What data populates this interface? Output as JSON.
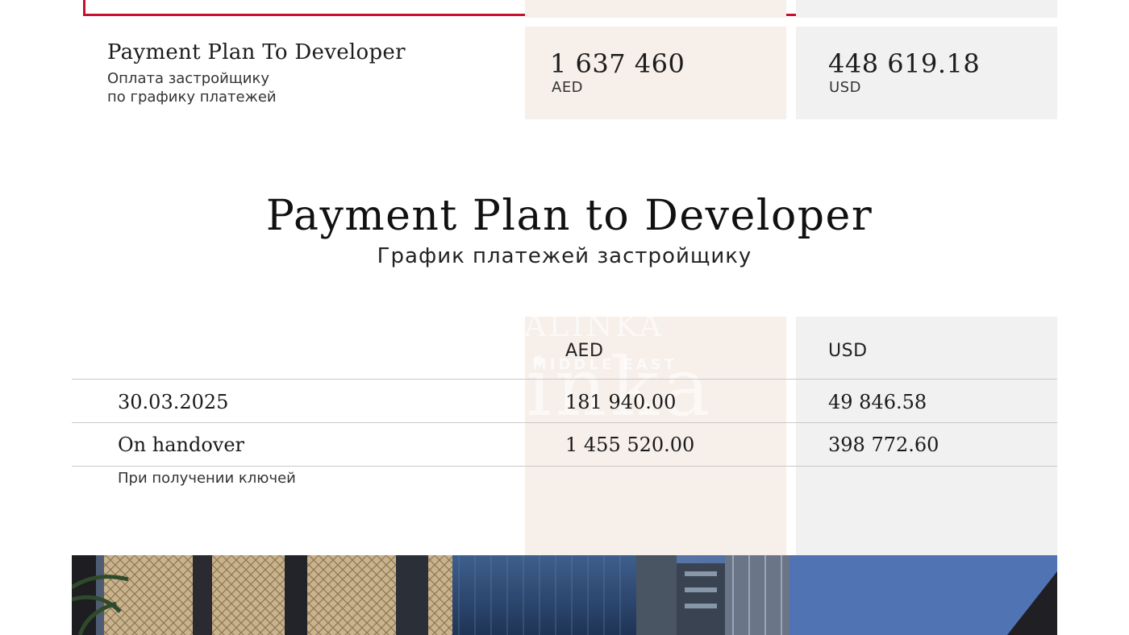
{
  "summary": {
    "label": "Payment Plan To Developer",
    "sublabel_line1": "Оплата застройщику",
    "sublabel_line2": "по графику платежей",
    "aed_amount": "1 637 460",
    "aed_currency": "AED",
    "usd_amount": "448 619.18",
    "usd_currency": "USD"
  },
  "section": {
    "title": "Payment Plan to Developer",
    "subtitle": "График платежей застройщику"
  },
  "table": {
    "columns": [
      "AED",
      "USD"
    ],
    "rows": [
      {
        "label": "30.03.2025",
        "aed": "181 940.00",
        "usd": "49 846.58"
      },
      {
        "label": "On handover",
        "aed": "1 455 520.00",
        "usd": "398 772.60",
        "note": "При получении ключей"
      }
    ]
  },
  "watermark": {
    "brand": "KALINKA",
    "line": "MIDDLE EAST",
    "big": "kalinka"
  },
  "colors": {
    "accent_red": "#c8102e",
    "aed_column": "#f6efea",
    "usd_column": "#f1f1f1"
  }
}
